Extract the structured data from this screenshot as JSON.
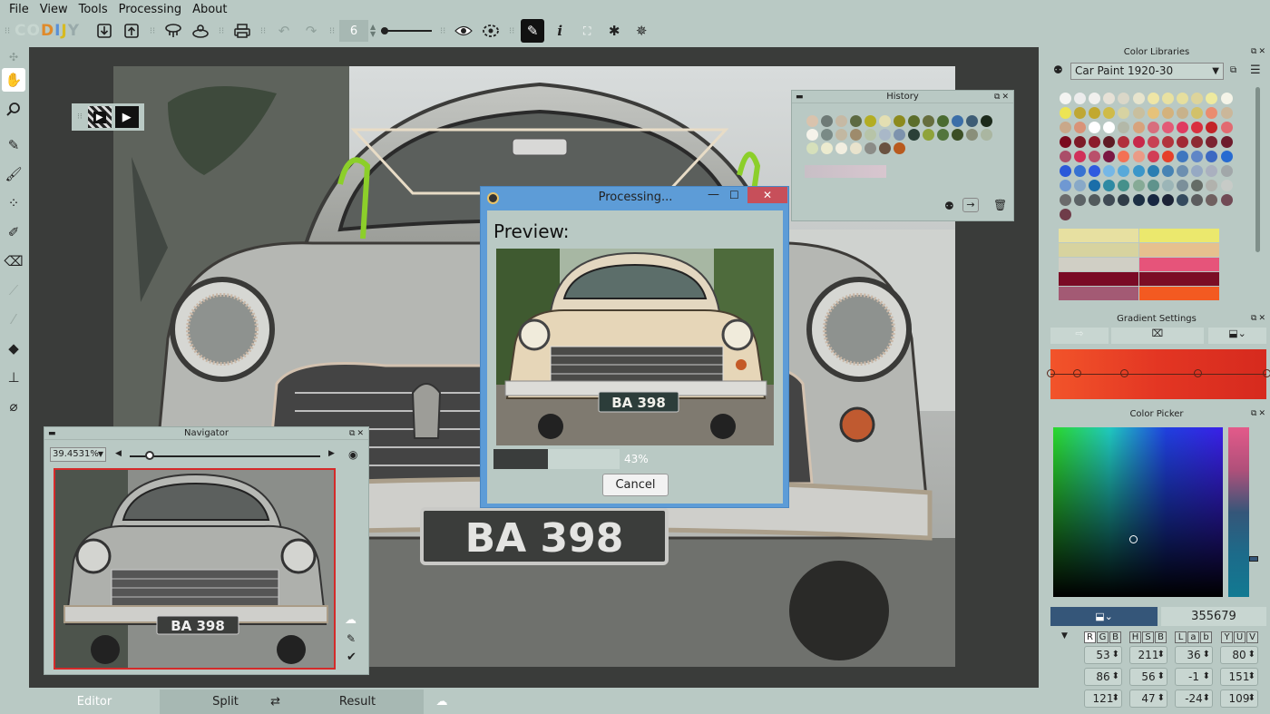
{
  "menu": [
    "File",
    "View",
    "Tools",
    "Processing",
    "About"
  ],
  "logo": "CODIJY",
  "toolbar": {
    "brush_size": "6",
    "icons": [
      "import-icon",
      "export-icon",
      "colorize-icon",
      "palette-icon",
      "print-icon",
      "undo-icon",
      "redo-icon",
      "eye-icon",
      "mask-icon",
      "pen-icon",
      "info-icon",
      "fit-icon",
      "settings-icon",
      "bug-icon"
    ]
  },
  "left_tools": [
    "hand-icon",
    "search-icon",
    "brush-icon",
    "marker-icon",
    "dots-icon",
    "pen-icon",
    "eraser-icon",
    "disabled-line-icon",
    "disabled-line2-icon",
    "fill-icon",
    "stamp-icon",
    "eyedropper-icon"
  ],
  "canvas": {
    "plate_text": "BA 398"
  },
  "navigator": {
    "title": "Navigator",
    "zoom": "39.4531%",
    "zoom_fraction": 0.08,
    "plate_text": "BA 398"
  },
  "history": {
    "title": "History",
    "swatches": [
      "#d9c3ad",
      "#6e7a76",
      "#c6b9a4",
      "#5d6a42",
      "#b3ad24",
      "#e3dfb2",
      "#8c8a1d",
      "#5b6d2a",
      "#666e3e",
      "#4a6b30",
      "#3b6ea8",
      "#3d5c75",
      "#1c2a1b",
      "#f5f3ea",
      "#7a8a86",
      "#c2b8a2",
      "#9e8b6c",
      "#b7c4a8",
      "#a9b8c8",
      "#7d93ad",
      "#2a4038",
      "#8fa33a",
      "#53753d",
      "#3c4f26",
      "#8a8f7a",
      "#aab6a1",
      "#d6e0bb",
      "#ecebcf",
      "#f2eee0",
      "#e9e3cd",
      "#8b8c87",
      "#6a5240",
      "#b85a1e"
    ],
    "strip_color": "#c8bfc6"
  },
  "dialog": {
    "title": "Processing...",
    "preview_label": "Preview:",
    "plate_text": "BA 398",
    "progress": 0.43,
    "progress_text": "43%",
    "cancel": "Cancel"
  },
  "color_libraries": {
    "title": "Color Libraries",
    "library": "Car Paint 1920-30",
    "swatches": [
      "#f4f4f2",
      "#ececec",
      "#f1f0ee",
      "#e6e1d6",
      "#dad7c8",
      "#e7e4cd",
      "#efe6a6",
      "#e8e1a1",
      "#e6df9e",
      "#ddd49b",
      "#eeea9f",
      "#f5f4e8",
      "#ece454",
      "#bfa735",
      "#c2a82f",
      "#cfbb49",
      "#d7d3a2",
      "#c9bf9e",
      "#e6c27a",
      "#d4b27c",
      "#c8b28b",
      "#d2c16a",
      "#ea8c6f",
      "#cbb79a",
      "#c9a88a",
      "#d99378",
      "#ffffff",
      "#ffffff",
      "#b3b8a8",
      "#d7a37c",
      "#d86e7d",
      "#e35a76",
      "#e03a60",
      "#d9303f",
      "#c32428",
      "#e26a71",
      "#7a0a1e",
      "#7d1a27",
      "#8c1c2b",
      "#5e1a24",
      "#b12e3b",
      "#c7284a",
      "#c84153",
      "#b2343c",
      "#a22934",
      "#8e2a32",
      "#7c2330",
      "#6e1b2c",
      "#aa4e69",
      "#d0315a",
      "#b9506b",
      "#7b1843",
      "#f37155",
      "#ea9b86",
      "#d23e56",
      "#e6402a",
      "#3f77bf",
      "#5f86c7",
      "#3c69c2",
      "#276bd1",
      "#2a59d9",
      "#3772d1",
      "#2f5be0",
      "#75b7e6",
      "#58a9d9",
      "#3b96c9",
      "#2a7eb2",
      "#4783b4",
      "#6c8fb0",
      "#96a9c3",
      "#aab0bf",
      "#a1a7a9",
      "#6f98d2",
      "#88a9c8",
      "#1a6ea9",
      "#2e8aa3",
      "#45908b",
      "#86aa96",
      "#5f938c",
      "#9bb5b7",
      "#7b8f9a",
      "#656c66",
      "#b1b2ad",
      "#c7cbc7",
      "#6b6b6b",
      "#5c6366",
      "#525a5c",
      "#3f4a54",
      "#2f3c47",
      "#1c2f44",
      "#172742",
      "#1c2336",
      "#344a5e",
      "#5b5c5e",
      "#706060",
      "#714a55",
      "#6f3c49"
    ],
    "gradients": [
      [
        "#e7e0a1",
        "#ebe86d"
      ],
      [
        "#d7d39f",
        "#e6c08e"
      ],
      [
        "#d0cfc5",
        "#e6547a"
      ],
      [
        "#7a0a25",
        "#7b0d25"
      ],
      [
        "#a35a74",
        "#f35a21"
      ]
    ]
  },
  "gradient_settings": {
    "title": "Gradient Settings",
    "stops": [
      0,
      0.12,
      0.34,
      0.68,
      1.0
    ],
    "colors": [
      "#f2542a",
      "#e33623",
      "#d62a1e"
    ]
  },
  "color_picker": {
    "title": "Color Picker",
    "hex": "355679",
    "modes": [
      "RGB",
      "HSB",
      "Lab",
      "YUV"
    ],
    "values": [
      [
        "53",
        "211",
        "36",
        "80"
      ],
      [
        "86",
        "56",
        "-1",
        "151"
      ],
      [
        "121",
        "47",
        "-24",
        "109"
      ]
    ]
  },
  "bottom": {
    "editor": "Editor",
    "split": "Split",
    "result": "Result"
  }
}
